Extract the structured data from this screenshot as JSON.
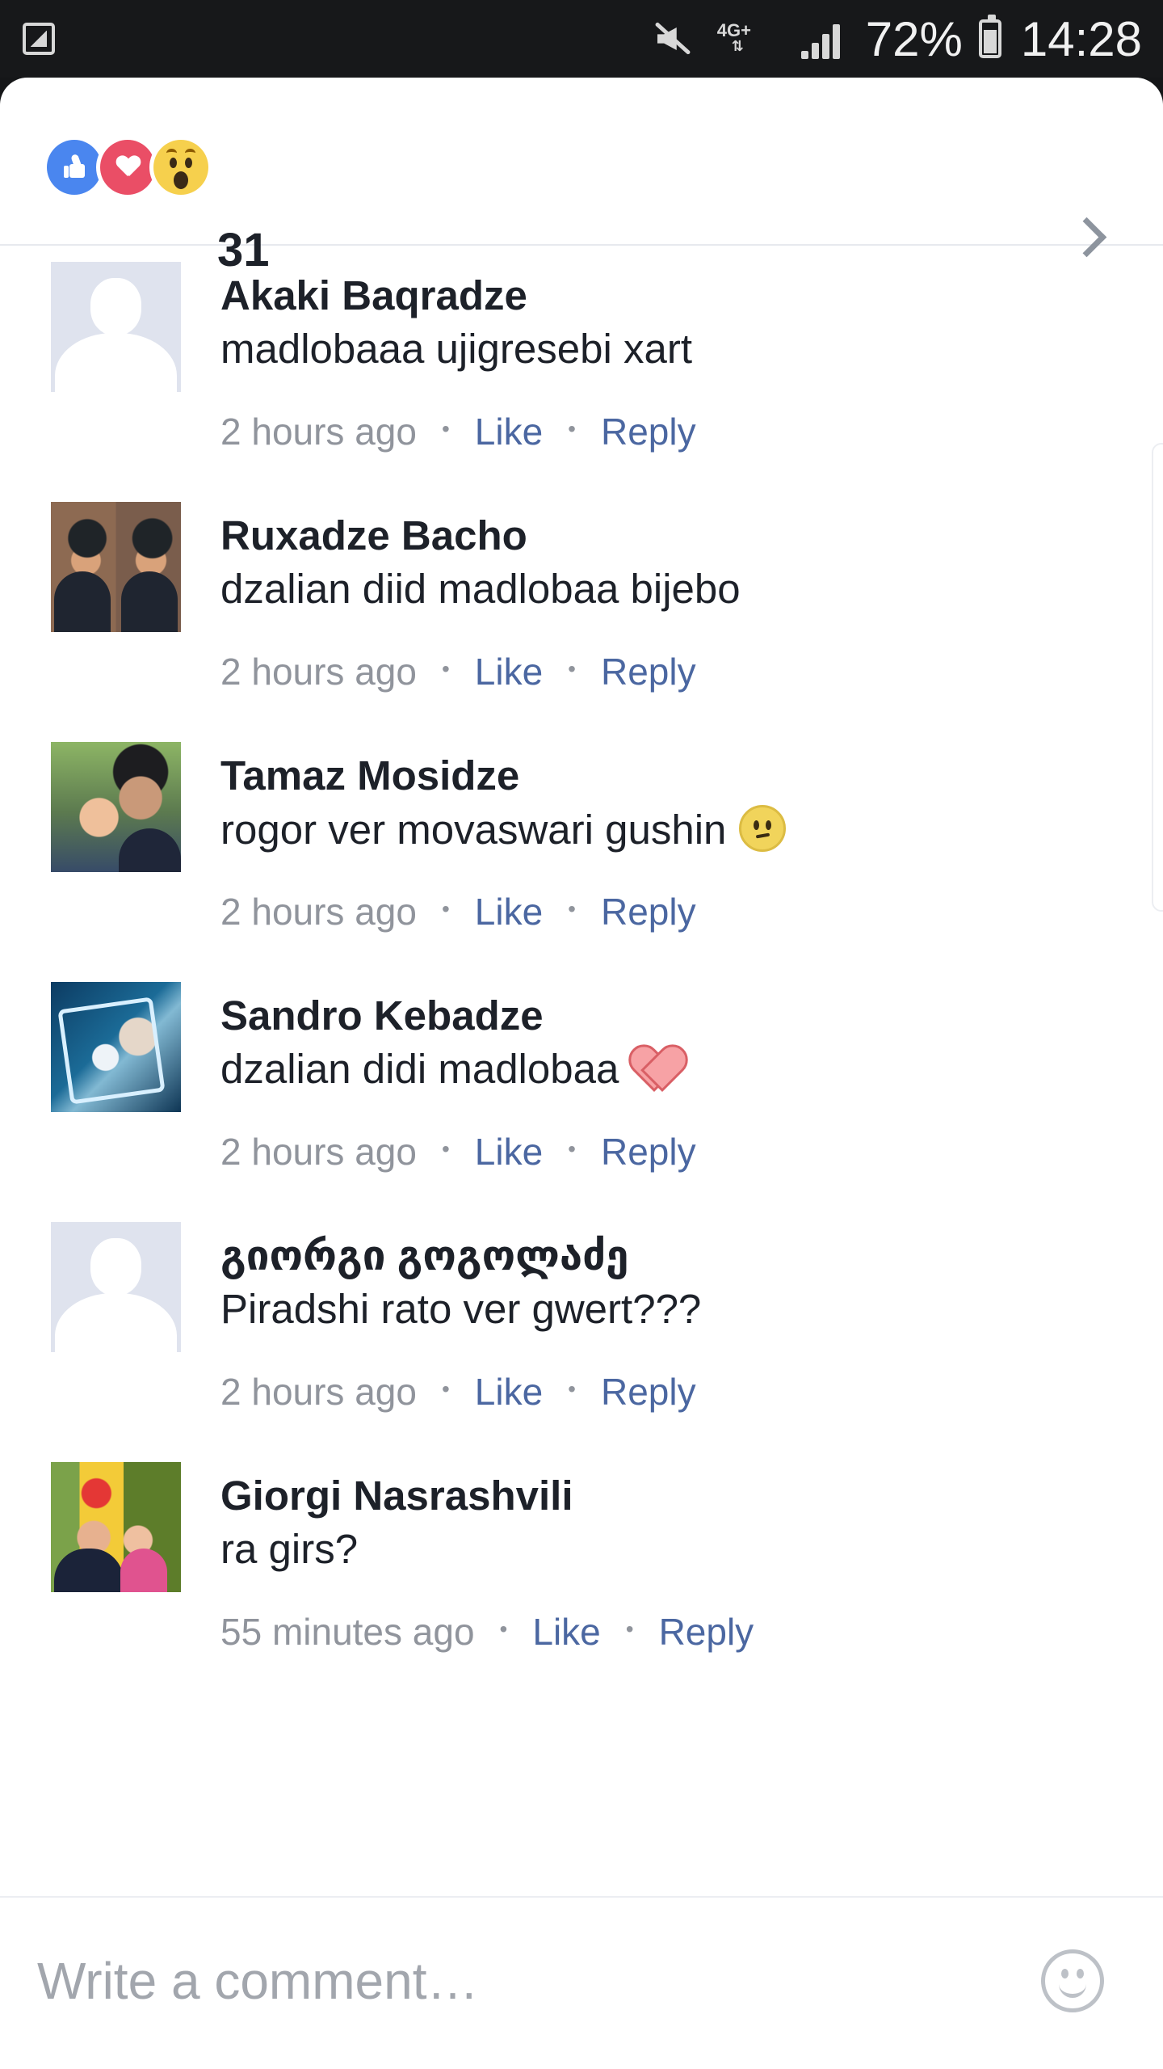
{
  "status_bar": {
    "battery": "72%",
    "time": "14:28",
    "network": "4G+",
    "icons": [
      "gallery-icon",
      "mute-icon",
      "network-icon",
      "signal-icon",
      "battery-icon"
    ]
  },
  "reactions": {
    "count": "31",
    "icons": [
      "like-icon",
      "love-icon",
      "wow-icon"
    ],
    "colors": {
      "like": "#4a86ef",
      "love": "#ea4e66",
      "wow": "#f6d04d"
    }
  },
  "comments": [
    {
      "author": "Akaki Baqradze",
      "text": "madlobaaa ujigresebi xart",
      "time": "2 hours ago",
      "like_label": "Like",
      "reply_label": "Reply"
    },
    {
      "author": "Ruxadze Bacho",
      "text": "dzalian diid madlobaa bijebo",
      "time": "2 hours ago",
      "like_label": "Like",
      "reply_label": "Reply"
    },
    {
      "author": "Tamaz Mosidze",
      "text": "rogor ver movaswari gushin",
      "time": "2 hours ago",
      "like_label": "Like",
      "reply_label": "Reply",
      "emoji": "slightly-frowning-face-icon"
    },
    {
      "author": "Sandro Kebadze",
      "text": "dzalian didi madlobaa",
      "time": "2 hours ago",
      "like_label": "Like",
      "reply_label": "Reply",
      "emoji": "heart-icon"
    },
    {
      "author": "გიორგი გოგოლაძე",
      "text": "Piradshi rato ver gwert???",
      "time": "2 hours ago",
      "like_label": "Like",
      "reply_label": "Reply"
    },
    {
      "author": "Giorgi Nasrashvili",
      "text": "ra girs?",
      "time": "55 minutes ago",
      "like_label": "Like",
      "reply_label": "Reply"
    }
  ],
  "composer": {
    "placeholder": "Write a comment…",
    "icon": "emoji-icon"
  },
  "theme": {
    "link_color": "#4b67a1",
    "muted_color": "#90949c",
    "text_color": "#1d2129",
    "divider_color": "#e7e9ee"
  }
}
